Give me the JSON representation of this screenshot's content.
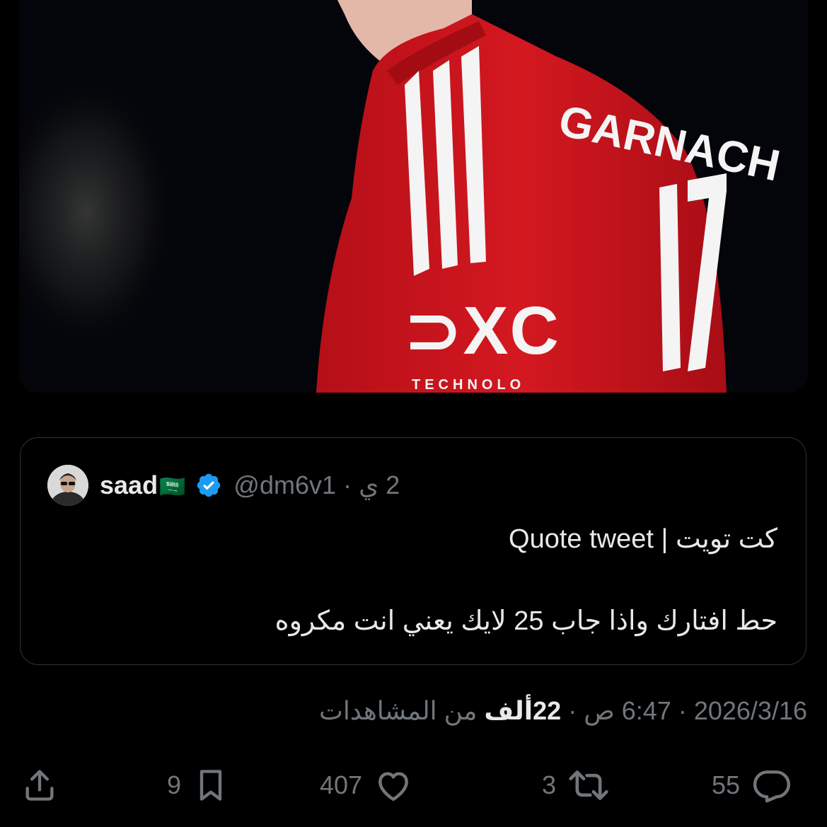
{
  "quoted_tweet": {
    "display_name": "saad",
    "flag": "🇸🇦",
    "handle": "@dm6v1",
    "time_ago": "2 ي",
    "separator": "·",
    "text_line_1": "كت تويت | Quote tweet",
    "text_line_2": "حط افتارك واذا جاب 25 لايك يعني انت مكروه"
  },
  "meta": {
    "date": "2026/3/16",
    "time": "6:47 ص",
    "views_number": "22",
    "views_unit": "ألف",
    "views_label": "من المشاهدات",
    "separator": "·"
  },
  "actions": {
    "reply_count": "55",
    "retweet_count": "3",
    "like_count": "407",
    "bookmark_count": "9"
  },
  "icons": {
    "verified": "verified-badge-icon",
    "reply": "reply-bubble-icon",
    "retweet": "retweet-icon",
    "like": "heart-icon",
    "bookmark": "bookmark-icon",
    "share": "share-upload-icon"
  },
  "colors": {
    "background": "#000000",
    "text_primary": "#e7e9ea",
    "text_secondary": "#71767b",
    "border": "#2f3336",
    "verified_blue": "#1d9bf0",
    "jersey_red": "#c8141c"
  }
}
